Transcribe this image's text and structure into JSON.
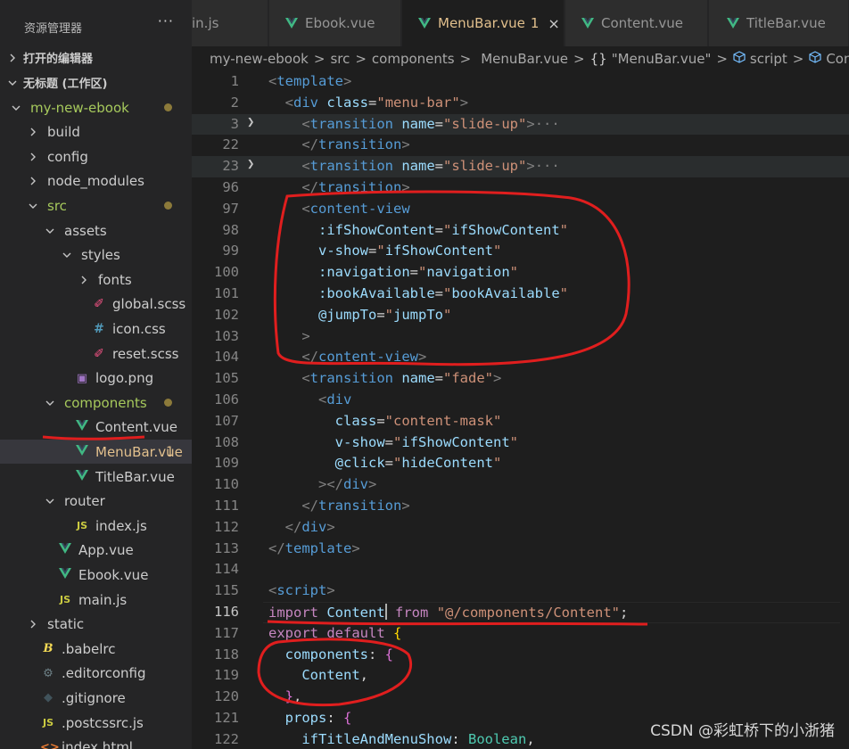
{
  "explorer": {
    "title": "资源管理器",
    "more": "···",
    "sections": {
      "open_editors": "打开的编辑器",
      "workspace": "无标题 (工作区)"
    },
    "tree": [
      {
        "label": "my-new-ebook",
        "icon": "folder-open-chevron",
        "depth": 0,
        "kind": "folder",
        "open": true,
        "modified": true
      },
      {
        "label": "build",
        "icon": "folder-closed-chevron",
        "depth": 1,
        "kind": "folder",
        "open": false
      },
      {
        "label": "config",
        "icon": "folder-closed-chevron",
        "depth": 1,
        "kind": "folder",
        "open": false
      },
      {
        "label": "node_modules",
        "icon": "folder-closed-chevron",
        "depth": 1,
        "kind": "folder",
        "open": false
      },
      {
        "label": "src",
        "icon": "folder-open-chevron",
        "depth": 1,
        "kind": "folder",
        "open": true,
        "modified": true
      },
      {
        "label": "assets",
        "icon": "folder-open-chevron",
        "depth": 2,
        "kind": "folder",
        "open": true
      },
      {
        "label": "styles",
        "icon": "folder-open-chevron",
        "depth": 3,
        "kind": "folder",
        "open": true
      },
      {
        "label": "fonts",
        "icon": "folder-closed-chevron",
        "depth": 4,
        "kind": "folder",
        "open": false
      },
      {
        "label": "global.scss",
        "icon": "scss-icon",
        "depth": 4,
        "kind": "scss"
      },
      {
        "label": "icon.css",
        "icon": "css-icon",
        "depth": 4,
        "kind": "css"
      },
      {
        "label": "reset.scss",
        "icon": "scss-icon",
        "depth": 4,
        "kind": "scss"
      },
      {
        "label": "logo.png",
        "icon": "image-icon",
        "depth": 3,
        "kind": "img"
      },
      {
        "label": "components",
        "icon": "folder-open-chevron",
        "depth": 2,
        "kind": "folder",
        "open": true,
        "modified": true
      },
      {
        "label": "Content.vue",
        "icon": "vue-icon",
        "depth": 3,
        "kind": "vue"
      },
      {
        "label": "MenuBar.vue",
        "icon": "vue-icon",
        "depth": 3,
        "kind": "vue",
        "selected": true,
        "problems": "1"
      },
      {
        "label": "TitleBar.vue",
        "icon": "vue-icon",
        "depth": 3,
        "kind": "vue"
      },
      {
        "label": "router",
        "icon": "folder-open-chevron",
        "depth": 2,
        "kind": "folder",
        "open": true
      },
      {
        "label": "index.js",
        "icon": "js-icon",
        "depth": 3,
        "kind": "js"
      },
      {
        "label": "App.vue",
        "icon": "vue-icon",
        "depth": 2,
        "kind": "vue"
      },
      {
        "label": "Ebook.vue",
        "icon": "vue-icon",
        "depth": 2,
        "kind": "vue"
      },
      {
        "label": "main.js",
        "icon": "js-icon",
        "depth": 2,
        "kind": "js"
      },
      {
        "label": "static",
        "icon": "folder-closed-chevron",
        "depth": 1,
        "kind": "folder",
        "open": false
      },
      {
        "label": ".babelrc",
        "icon": "babel-icon",
        "depth": 1,
        "kind": "babel"
      },
      {
        "label": ".editorconfig",
        "icon": "gear-icon",
        "depth": 1,
        "kind": "gear"
      },
      {
        "label": ".gitignore",
        "icon": "git-icon",
        "depth": 1,
        "kind": "git"
      },
      {
        "label": ".postcssrc.js",
        "icon": "js-icon",
        "depth": 1,
        "kind": "js"
      },
      {
        "label": "index.html",
        "icon": "html-icon",
        "depth": 1,
        "kind": "html"
      }
    ]
  },
  "tabs": [
    {
      "label": "in.js",
      "icon": "js-icon",
      "active": false
    },
    {
      "label": "Ebook.vue",
      "icon": "vue-icon",
      "active": false
    },
    {
      "label": "MenuBar.vue",
      "icon": "vue-icon",
      "active": true,
      "problems": "1",
      "close": "×"
    },
    {
      "label": "Content.vue",
      "icon": "vue-icon",
      "active": false
    },
    {
      "label": "TitleBar.vue",
      "icon": "vue-icon",
      "active": false
    }
  ],
  "breadcrumb": {
    "items": [
      "my-new-ebook",
      "src",
      "components",
      "MenuBar.vue",
      "\"MenuBar.vue\"",
      "script",
      "Conte"
    ],
    "separator": ">",
    "braces": "{}"
  },
  "editor": {
    "lines": [
      {
        "n": "1",
        "fold": "",
        "bg": false,
        "html": "<span class=\"t-punc\">&lt;</span><span class=\"t-tag\">template</span><span class=\"t-punc\">&gt;</span>"
      },
      {
        "n": "2",
        "fold": "",
        "bg": false,
        "html": "  <span class=\"t-punc\">&lt;</span><span class=\"t-tag\">div</span> <span class=\"t-attr\">class</span><span class=\"t-plain\">=</span><span class=\"t-str\">\"menu-bar\"</span><span class=\"t-punc\">&gt;</span>"
      },
      {
        "n": "3",
        "fold": ">",
        "bg": true,
        "html": "    <span class=\"t-punc\">&lt;</span><span class=\"t-tag\">transition</span> <span class=\"t-attr\">name</span><span class=\"t-plain\">=</span><span class=\"t-str\">\"slide-up\"</span><span class=\"t-punc\">&gt;</span><span class=\"t-fold-dots\">···</span>"
      },
      {
        "n": "22",
        "fold": "",
        "bg": false,
        "html": "    <span class=\"t-punc\">&lt;/</span><span class=\"t-tag\">transition</span><span class=\"t-punc\">&gt;</span>"
      },
      {
        "n": "23",
        "fold": ">",
        "bg": true,
        "html": "    <span class=\"t-punc\">&lt;</span><span class=\"t-tag\">transition</span> <span class=\"t-attr\">name</span><span class=\"t-plain\">=</span><span class=\"t-str\">\"slide-up\"</span><span class=\"t-punc\">&gt;</span><span class=\"t-fold-dots\">···</span>"
      },
      {
        "n": "96",
        "fold": "",
        "bg": false,
        "html": "    <span class=\"t-punc\">&lt;/</span><span class=\"t-tag\">transition</span><span class=\"t-punc\">&gt;</span>"
      },
      {
        "n": "97",
        "fold": "",
        "bg": false,
        "html": "    <span class=\"t-punc\">&lt;</span><span class=\"t-tag\">content-view</span>"
      },
      {
        "n": "98",
        "fold": "",
        "bg": false,
        "html": "      <span class=\"t-attr\">:ifShowContent</span><span class=\"t-plain\">=</span><span class=\"t-str\">\"</span><span class=\"t-var\">ifShowContent</span><span class=\"t-str\">\"</span>"
      },
      {
        "n": "99",
        "fold": "",
        "bg": false,
        "html": "      <span class=\"t-attr\">v-show</span><span class=\"t-plain\">=</span><span class=\"t-str\">\"</span><span class=\"t-var\">ifShowContent</span><span class=\"t-str\">\"</span>"
      },
      {
        "n": "100",
        "fold": "",
        "bg": false,
        "html": "      <span class=\"t-attr\">:navigation</span><span class=\"t-plain\">=</span><span class=\"t-str\">\"</span><span class=\"t-var\">navigation</span><span class=\"t-str\">\"</span>"
      },
      {
        "n": "101",
        "fold": "",
        "bg": false,
        "html": "      <span class=\"t-attr\">:bookAvailable</span><span class=\"t-plain\">=</span><span class=\"t-str\">\"</span><span class=\"t-var\">bookAvailable</span><span class=\"t-str\">\"</span>"
      },
      {
        "n": "102",
        "fold": "",
        "bg": false,
        "html": "      <span class=\"t-attr\">@jumpTo</span><span class=\"t-plain\">=</span><span class=\"t-str\">\"</span><span class=\"t-var\">jumpTo</span><span class=\"t-str\">\"</span>"
      },
      {
        "n": "103",
        "fold": "",
        "bg": false,
        "html": "    <span class=\"t-punc\">&gt;</span>"
      },
      {
        "n": "104",
        "fold": "",
        "bg": false,
        "html": "    <span class=\"t-punc\">&lt;/</span><span class=\"t-tag\">content-view</span><span class=\"t-punc\">&gt;</span>"
      },
      {
        "n": "105",
        "fold": "",
        "bg": false,
        "html": "    <span class=\"t-punc\">&lt;</span><span class=\"t-tag\">transition</span> <span class=\"t-attr\">name</span><span class=\"t-plain\">=</span><span class=\"t-str\">\"fade\"</span><span class=\"t-punc\">&gt;</span>"
      },
      {
        "n": "106",
        "fold": "",
        "bg": false,
        "html": "      <span class=\"t-punc\">&lt;</span><span class=\"t-tag\">div</span>"
      },
      {
        "n": "107",
        "fold": "",
        "bg": false,
        "html": "        <span class=\"t-attr\">class</span><span class=\"t-plain\">=</span><span class=\"t-str\">\"content-mask\"</span>"
      },
      {
        "n": "108",
        "fold": "",
        "bg": false,
        "html": "        <span class=\"t-attr\">v-show</span><span class=\"t-plain\">=</span><span class=\"t-str\">\"</span><span class=\"t-var\">ifShowContent</span><span class=\"t-str\">\"</span>"
      },
      {
        "n": "109",
        "fold": "",
        "bg": false,
        "html": "        <span class=\"t-attr\">@click</span><span class=\"t-plain\">=</span><span class=\"t-str\">\"</span><span class=\"t-var\">hideContent</span><span class=\"t-str\">\"</span>"
      },
      {
        "n": "110",
        "fold": "",
        "bg": false,
        "html": "      <span class=\"t-punc\">&gt;&lt;/</span><span class=\"t-tag\">div</span><span class=\"t-punc\">&gt;</span>"
      },
      {
        "n": "111",
        "fold": "",
        "bg": false,
        "html": "    <span class=\"t-punc\">&lt;/</span><span class=\"t-tag\">transition</span><span class=\"t-punc\">&gt;</span>"
      },
      {
        "n": "112",
        "fold": "",
        "bg": false,
        "html": "  <span class=\"t-punc\">&lt;/</span><span class=\"t-tag\">div</span><span class=\"t-punc\">&gt;</span>"
      },
      {
        "n": "113",
        "fold": "",
        "bg": false,
        "html": "<span class=\"t-punc\">&lt;/</span><span class=\"t-tag\">template</span><span class=\"t-punc\">&gt;</span>"
      },
      {
        "n": "114",
        "fold": "",
        "bg": false,
        "html": ""
      },
      {
        "n": "115",
        "fold": "",
        "bg": false,
        "html": "<span class=\"t-punc\">&lt;</span><span class=\"t-tag\">script</span><span class=\"t-punc\">&gt;</span>"
      },
      {
        "n": "116",
        "fold": "",
        "bg": false,
        "active": true,
        "html": "<span class=\"t-kw\">import</span> <span class=\"t-var\">Content</span><span class=\"caret\"></span> <span class=\"t-kw\">from</span> <span class=\"t-str\">\"@/components/Content\"</span><span class=\"t-plain\">;</span>"
      },
      {
        "n": "117",
        "fold": "",
        "bg": false,
        "html": "<span class=\"t-kw\">export</span> <span class=\"t-kw\">default</span> <span class=\"t-brace2\">{</span>"
      },
      {
        "n": "118",
        "fold": "",
        "bg": false,
        "html": "  <span class=\"t-var\">components</span><span class=\"t-plain\">: </span><span class=\"t-brace\">{</span>"
      },
      {
        "n": "119",
        "fold": "",
        "bg": false,
        "html": "    <span class=\"t-var\">Content</span><span class=\"t-plain\">,</span>"
      },
      {
        "n": "120",
        "fold": "",
        "bg": false,
        "html": "  <span class=\"t-brace\">}</span><span class=\"t-plain\">,</span>"
      },
      {
        "n": "121",
        "fold": "",
        "bg": false,
        "html": "  <span class=\"t-var\">props</span><span class=\"t-plain\">: </span><span class=\"t-brace\">{</span>"
      },
      {
        "n": "122",
        "fold": "",
        "bg": false,
        "html": "    <span class=\"t-var\">ifTitleAndMenuShow</span><span class=\"t-plain\">: </span><span class=\"t-type\">Boolean</span><span class=\"t-plain\">,</span>"
      }
    ]
  },
  "watermark": "CSDN @彩虹桥下的小浙猪",
  "colors": {
    "annotation": "#e01e1e",
    "vue_green": "#41b883",
    "modified_orange": "#e2c08d"
  }
}
